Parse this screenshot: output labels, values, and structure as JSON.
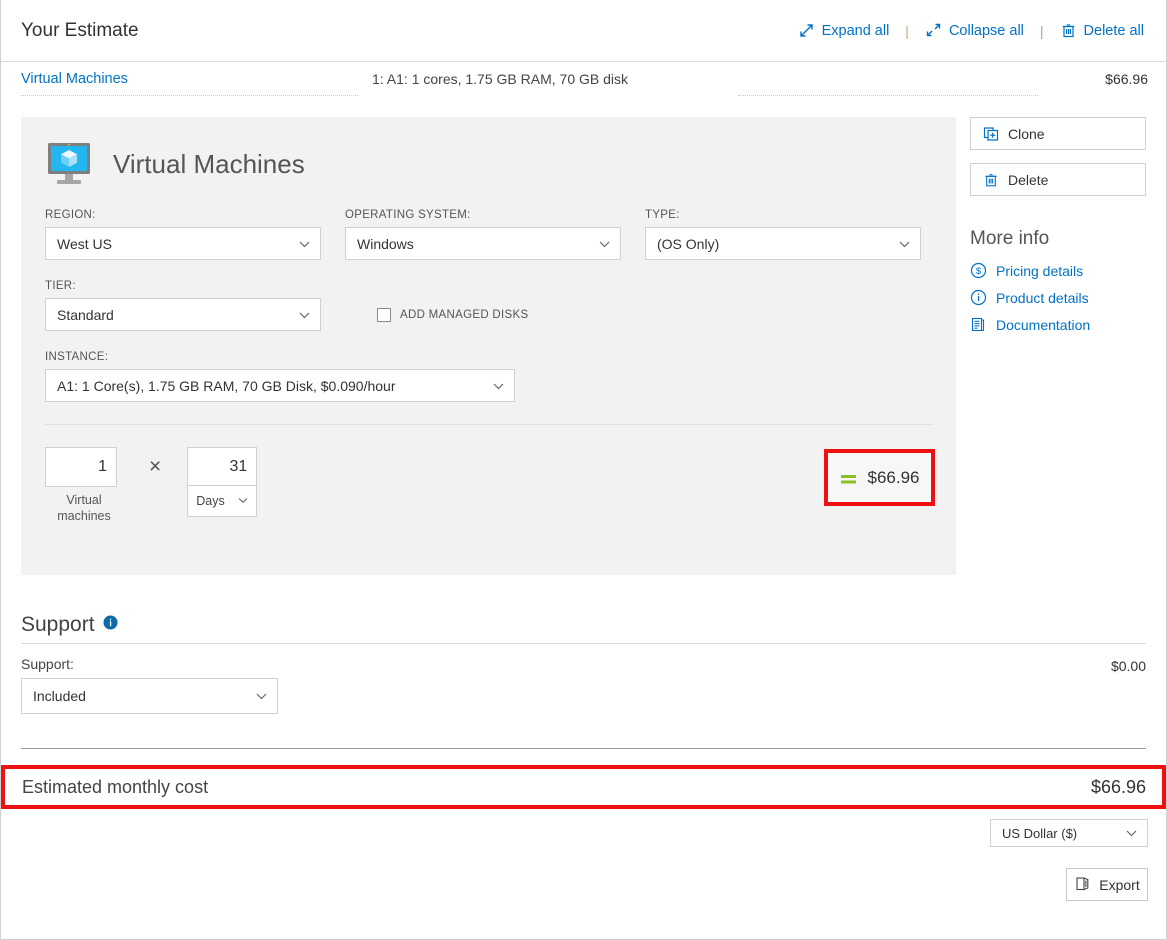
{
  "header": {
    "title": "Your Estimate",
    "actions": [
      {
        "label": "Expand all",
        "icon": "expand-all-icon"
      },
      {
        "label": "Collapse all",
        "icon": "collapse-all-icon"
      },
      {
        "label": "Delete all",
        "icon": "trash-icon"
      }
    ],
    "separator": "|"
  },
  "summary": {
    "name": "Virtual Machines",
    "description": "1: A1: 1 cores, 1.75 GB RAM, 70 GB disk",
    "price": "$66.96"
  },
  "card": {
    "title": "Virtual Machines",
    "icon": "virtual-machine-icon",
    "fields": {
      "region": {
        "label": "REGION:",
        "value": "West US"
      },
      "operating_system": {
        "label": "OPERATING SYSTEM:",
        "value": "Windows"
      },
      "type": {
        "label": "TYPE:",
        "value": "(OS Only)"
      },
      "tier": {
        "label": "TIER:",
        "value": "Standard"
      },
      "instance": {
        "label": "INSTANCE:",
        "value": "A1: 1 Core(s), 1.75 GB RAM, 70 GB Disk, $0.090/hour"
      }
    },
    "managed_disks": {
      "label": "ADD MANAGED DISKS",
      "checked": false
    },
    "calc": {
      "quantity": "1",
      "quantity_caption": "Virtual machines",
      "operator": "×",
      "days_value": "31",
      "days_unit": "Days",
      "equals_icon": "equals-icon",
      "total": "$66.96"
    }
  },
  "sidebar": {
    "buttons": [
      {
        "label": "Clone",
        "icon": "clone-icon"
      },
      {
        "label": "Delete",
        "icon": "trash-icon"
      }
    ],
    "more_info_title": "More info",
    "links": [
      {
        "label": "Pricing details",
        "icon": "dollar-circle-icon"
      },
      {
        "label": "Product details",
        "icon": "info-circle-icon"
      },
      {
        "label": "Documentation",
        "icon": "documentation-icon"
      }
    ]
  },
  "support": {
    "title": "Support",
    "info_icon": "info-circle-icon",
    "field_label": "Support:",
    "value": "Included",
    "price": "$0.00"
  },
  "footer": {
    "total_label": "Estimated monthly cost",
    "total_value": "$66.96",
    "currency": "US Dollar ($)",
    "export_label": "Export",
    "export_icon": "export-icon"
  },
  "colors": {
    "link": "#0072c6",
    "highlight_border": "#ee1111",
    "equals_green": "#8cbf26",
    "card_background": "#f2f2f2"
  }
}
